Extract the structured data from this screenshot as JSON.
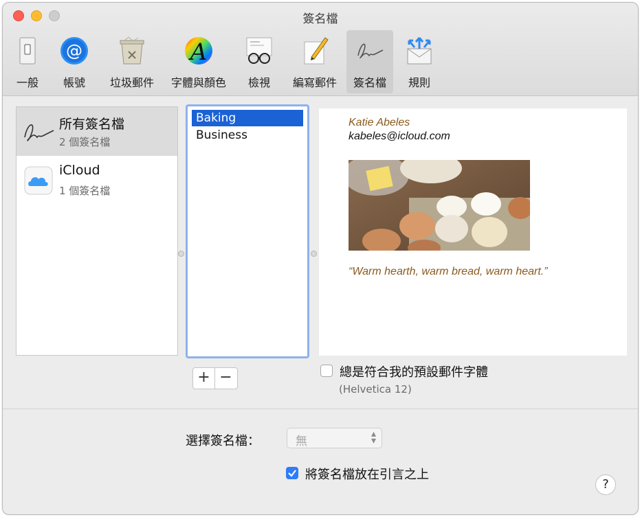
{
  "window": {
    "title": "簽名檔"
  },
  "toolbar": {
    "items": [
      {
        "label": "一般",
        "icon": "switch-icon"
      },
      {
        "label": "帳號",
        "icon": "at-icon"
      },
      {
        "label": "垃圾郵件",
        "icon": "junk-trash-icon"
      },
      {
        "label": "字體與顏色",
        "icon": "font-color-icon"
      },
      {
        "label": "檢視",
        "icon": "glasses-icon"
      },
      {
        "label": "編寫郵件",
        "icon": "compose-pencil-icon"
      },
      {
        "label": "簽名檔",
        "icon": "signature-icon",
        "selected": true
      },
      {
        "label": "規則",
        "icon": "rules-envelope-icon"
      }
    ]
  },
  "accounts": [
    {
      "title": "所有簽名檔",
      "subtitle": "2 個簽名檔",
      "icon": "signature-icon",
      "selected": true
    },
    {
      "title": "iCloud",
      "subtitle": "1 個簽名檔",
      "icon": "icloud-icon"
    }
  ],
  "signatures": [
    {
      "label": "Baking",
      "selected": true
    },
    {
      "label": "Business"
    }
  ],
  "buttons": {
    "add": "+",
    "remove": "−"
  },
  "preview": {
    "name": "Katie Abeles",
    "email": "kabeles@icloud.com",
    "quote": "“Warm hearth, warm bread, warm heart.”",
    "image": "eggs-baking-photo"
  },
  "options": {
    "match_font_label": "總是符合我的預設郵件字體",
    "match_font_checked": false,
    "font_hint": "(Helvetica 12)",
    "choose_label": "選擇簽名檔：",
    "choose_value": "無",
    "above_quote_label": "將簽名檔放在引言之上",
    "above_quote_checked": true
  },
  "help": "?",
  "colors": {
    "accent": "#1b62d5",
    "selection_ring": "#8fb1ea",
    "preview_brown": "#8a5a1e"
  }
}
